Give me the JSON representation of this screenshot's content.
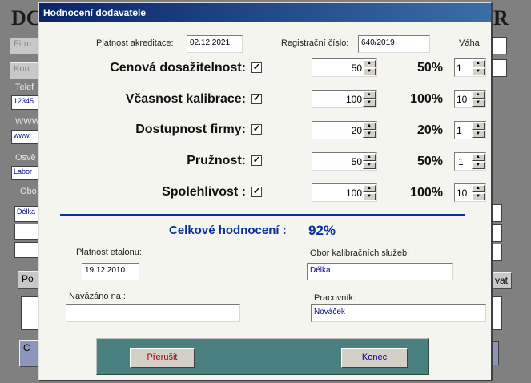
{
  "background": {
    "title_left": "DC",
    "title_right": "R",
    "buttons": [
      "Firm",
      "Kon"
    ],
    "phone_label": "Telef",
    "phone_value": "12345",
    "www_label": "WWW",
    "www_value": "www.",
    "osv_label": "Osvě",
    "osv_value": "Labor",
    "obor_label": "Obo",
    "delka_value": "Délka",
    "po_button": "Po",
    "vat_button": "vat",
    "c_button": "C"
  },
  "dialog": {
    "title": "Hodnocení dodavatele",
    "platnost_akreditace_label": "Platnost akreditace:",
    "platnost_akreditace_value": "02.12.2021",
    "registracni_cislo_label": "Registrační číslo:",
    "registracni_cislo_value": "640/2019",
    "vaha_label": "Váha",
    "criteria": [
      {
        "label": "Cenová dosažitelnost:",
        "checked": "✓",
        "score": "50",
        "percent": "50%",
        "weight": "1"
      },
      {
        "label": "Včasnost kalibrace:",
        "checked": "✓",
        "score": "100",
        "percent": "100%",
        "weight": "10"
      },
      {
        "label": "Dostupnost firmy:",
        "checked": "✓",
        "score": "20",
        "percent": "20%",
        "weight": "1"
      },
      {
        "label": "Pružnost:",
        "checked": "✓",
        "score": "50",
        "percent": "50%",
        "weight": "1"
      },
      {
        "label": "Spolehlivost :",
        "checked": "✓",
        "score": "100",
        "percent": "100%",
        "weight": "10"
      }
    ],
    "celkove_label": "Celkové hodnocení :",
    "celkove_value": "92%",
    "platnost_etalonu_label": "Platnost etalonu:",
    "platnost_etalonu_value": "19.12.2010",
    "obor_label": "Obor kalibračních služeb:",
    "obor_value": "Délka",
    "navazano_label": "Navázáno na :",
    "navazano_value": "",
    "pracovnik_label": "Pracovník:",
    "pracovnik_value": "Nováček",
    "prerusit_button": "Přerušit",
    "konec_button": "Konec"
  },
  "colors": {
    "titlebar": "#0a246a",
    "accent_text": "#0a2f9a",
    "button_panel": "#4b8080",
    "cancel_text": "#9a0000"
  }
}
